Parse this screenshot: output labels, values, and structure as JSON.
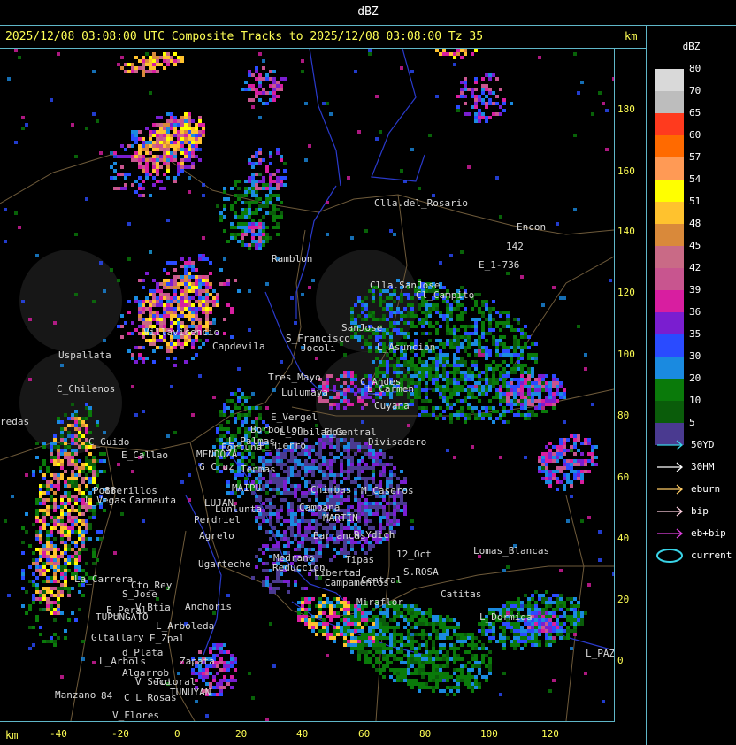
{
  "title": "dBZ",
  "header": "2025/12/08 03:08:00 UTC Composite Tracks to 2025/12/08 03:08:00 Tz 35",
  "units": {
    "top": "km",
    "bottom": "km"
  },
  "y_axis_ticks": [
    "180",
    "160",
    "140",
    "120",
    "100",
    "80",
    "60",
    "40",
    "20",
    "0"
  ],
  "x_axis_ticks": [
    "-40",
    "-20",
    "0",
    "20",
    "40",
    "60",
    "80",
    "100",
    "120"
  ],
  "legend": {
    "title": "dBZ",
    "levels": [
      {
        "label": "80",
        "color": "#d9d9d9"
      },
      {
        "label": "70",
        "color": "#bdbdbd"
      },
      {
        "label": "65",
        "color": "#ff3a1e"
      },
      {
        "label": "60",
        "color": "#ff6a00"
      },
      {
        "label": "57",
        "color": "#ff9a55"
      },
      {
        "label": "54",
        "color": "#ffff00"
      },
      {
        "label": "51",
        "color": "#ffc22e"
      },
      {
        "label": "48",
        "color": "#d9893a"
      },
      {
        "label": "45",
        "color": "#c96a86"
      },
      {
        "label": "42",
        "color": "#c8558f"
      },
      {
        "label": "39",
        "color": "#d81ea0"
      },
      {
        "label": "36",
        "color": "#7a1ed0"
      },
      {
        "label": "35",
        "color": "#2a4bff"
      },
      {
        "label": "30",
        "color": "#1a8ae0"
      },
      {
        "label": "20",
        "color": "#0a7a0a"
      },
      {
        "label": "10",
        "color": "#0a5c0a"
      },
      {
        "label": "5",
        "color": "#4a3a90"
      }
    ],
    "tracks": [
      {
        "label": "50YD",
        "color": "#39d3e6"
      },
      {
        "label": "30HM",
        "color": "#ffffff"
      },
      {
        "label": "eburn",
        "color": "#ffcc66"
      },
      {
        "label": "bip",
        "color": "#ffd0e0"
      },
      {
        "label": "eb+bip",
        "color": "#e040e0"
      },
      {
        "label": "current",
        "color": "#39d3e6"
      }
    ]
  },
  "places": [
    "Clla.del_Rosario",
    "Encon",
    "142",
    "E_1-736",
    "Ramblon",
    "Clla.SanJose",
    "Cl_Campito",
    "Uspallata",
    "Villavicencio",
    "Capdevila",
    "S_Francisco",
    "SanJose",
    "L_Asuncion",
    "Jocoli",
    "Tres_Mayo",
    "C_Chilenos",
    "Lulumaya",
    "C_Andes",
    "L_Carmen",
    "Cuyana",
    "Borbollon",
    "E_Vergel",
    "L_Jubilados",
    "E_Central",
    "Divisadero",
    "P_Hierro",
    "MENDOZA",
    "C_Guido",
    "E_Callao",
    "L_Palmas",
    "Fortuna",
    "G_Cruz",
    "Tenmas",
    "Chimbas",
    "M_Caseros",
    "MAIPU",
    "Potrerillos",
    "L_Vegas",
    "Carmeuta",
    "LUJAN",
    "Lunlunta",
    "Perdriel",
    "Campana",
    "Agrelo",
    "MARTIN",
    "R_Ydich",
    "Barrancas",
    "12_Oct",
    "S.ROSA",
    "Lomas_Blancas",
    "Ugarteche",
    "Medrano",
    "Reduccion",
    "Tipas",
    "Libertad",
    "Campamentos",
    "Central",
    "La_Carrera",
    "Cto_Rey",
    "S_Jose",
    "E_Peral",
    "V_Btia",
    "TUPUNGATO",
    "Anchoris",
    "Catitas",
    "L_Arboleda",
    "Miraflor",
    "L_Dormida",
    "Gltallary",
    "E_Zpal",
    "d_Plata",
    "L_Arbols",
    "Zapata",
    "L_PAZ",
    "Algarrob",
    "V_Seco",
    "Totoral",
    "Manzano",
    "TUNUYAN",
    "C_L_Rosas",
    "V_Flores",
    "redas",
    "88",
    "84"
  ]
}
